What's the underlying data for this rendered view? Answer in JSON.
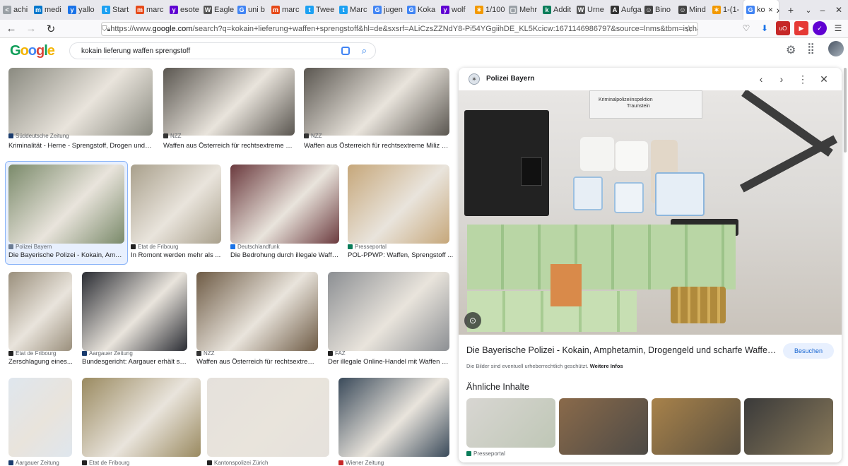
{
  "browser": {
    "tabs": [
      {
        "label": "achi",
        "color": "#9aa0a6",
        "glyph": "<"
      },
      {
        "label": "medi",
        "color": "#0077cc",
        "glyph": "m"
      },
      {
        "label": "yallo",
        "color": "#1a73e8",
        "glyph": "y"
      },
      {
        "label": "Start",
        "color": "#1da1f2",
        "glyph": "t"
      },
      {
        "label": "marc",
        "color": "#e64a19",
        "glyph": "m"
      },
      {
        "label": "esote",
        "color": "#6001d2",
        "glyph": "y"
      },
      {
        "label": "Eagle",
        "color": "#555555",
        "glyph": "W"
      },
      {
        "label": "uni b",
        "color": "#4285f4",
        "glyph": "G"
      },
      {
        "label": "marc",
        "color": "#e64a19",
        "glyph": "m"
      },
      {
        "label": "Twee",
        "color": "#1da1f2",
        "glyph": "t"
      },
      {
        "label": "Marc",
        "color": "#1da1f2",
        "glyph": "t"
      },
      {
        "label": "jugen",
        "color": "#4285f4",
        "glyph": "G"
      },
      {
        "label": "Koka",
        "color": "#4285f4",
        "glyph": "G"
      },
      {
        "label": "wolf",
        "color": "#6001d2",
        "glyph": "y"
      },
      {
        "label": "1/100",
        "color": "#f29900",
        "glyph": "✶"
      },
      {
        "label": "Mehr",
        "color": "#9aa0a6",
        "glyph": "▢"
      },
      {
        "label": "Addit",
        "color": "#0a7d5a",
        "glyph": "k"
      },
      {
        "label": "Urne",
        "color": "#555555",
        "glyph": "W"
      },
      {
        "label": "Aufga",
        "color": "#333333",
        "glyph": "A"
      },
      {
        "label": "Bino",
        "color": "#444444",
        "glyph": "☺"
      },
      {
        "label": "Mind",
        "color": "#444444",
        "glyph": "☺"
      },
      {
        "label": "1-(1-",
        "color": "#f29900",
        "glyph": "✶"
      },
      {
        "label": "ko",
        "color": "#4285f4",
        "glyph": "G"
      }
    ],
    "new_tab": "+",
    "url_prefix": "https://www.",
    "url_domain": "google.com",
    "url_rest": "/search?q=kokain+lieferung+waffen+sprengstoff&hl=de&sxsrf=ALiCzsZZNdY8-Pi54YGgiihDE_KL5Kcicw:1671146986797&source=lnms&tbm=isch&sa=X&ved"
  },
  "google": {
    "logo_letters": [
      [
        "G",
        "#0f9d58"
      ],
      [
        "o",
        "#f4b400"
      ],
      [
        "o",
        "#4285f4"
      ],
      [
        "g",
        "#db4437"
      ],
      [
        "l",
        "#0f9d58"
      ],
      [
        "e",
        "#f4b400"
      ]
    ],
    "query": "kokain lieferung waffen sprengstoff"
  },
  "results": [
    {
      "source": "Süddeutsche Zeitung",
      "title": "Kriminalität - Herne - Sprengstoff, Drogen und W...",
      "icon": "#1a3c6e",
      "bg": "#8a8a80"
    },
    {
      "source": "NZZ",
      "title": "Waffen aus Österreich für rechtsextreme Mil...",
      "icon": "#333333",
      "bg": "#5a5650"
    },
    {
      "source": "NZZ",
      "title": "Waffen aus Österreich für rechtsextreme Miliz in ...",
      "icon": "#333333",
      "bg": "#5a5650"
    },
    {
      "source": "Polizei Bayern",
      "title": "Die Bayerische Polizei - Kokain, Amp...",
      "icon": "#6b7c93",
      "bg": "#7a8a6a"
    },
    {
      "source": "Etat de Fribourg",
      "title": "In Romont werden mehr als ...",
      "icon": "#222222",
      "bg": "#a9a08c"
    },
    {
      "source": "Deutschlandfunk",
      "title": "Die Bedrohung durch illegale Waffe...",
      "icon": "#1a73e8",
      "bg": "#6b3a3e"
    },
    {
      "source": "Presseportal",
      "title": "POL-PPWP: Waffen, Sprengstoff ...",
      "icon": "#0a7d5a",
      "bg": "#c6a77a"
    },
    {
      "source": "Etat de Fribourg",
      "title": "Zerschlagung eines...",
      "icon": "#222222",
      "bg": "#9a8f7c"
    },
    {
      "source": "Aargauer Zeitung",
      "title": "Bundesgericht: Aargauer erhält sei...",
      "icon": "#1a3c6e",
      "bg": "#2a2c33"
    },
    {
      "source": "NZZ",
      "title": "Waffen aus Österreich für rechtsextreme...",
      "icon": "#333333",
      "bg": "#6e5b45"
    },
    {
      "source": "FAZ",
      "title": "Der illegale Online-Handel mit Waffen un...",
      "icon": "#222222",
      "bg": "#8c8f93"
    },
    {
      "source": "Aargauer Zeitung",
      "title": "",
      "icon": "#1a3c6e",
      "bg": "#dfe6ee"
    },
    {
      "source": "Etat de Fribourg",
      "title": "",
      "icon": "#222222",
      "bg": "#9a8a60"
    },
    {
      "source": "Kantonspolizei Zürich",
      "title": "",
      "icon": "#222222",
      "bg": "#e5e1dc"
    },
    {
      "source": "Wiener Zeitung",
      "title": "",
      "icon": "#c62828",
      "bg": "#3a4a5a"
    }
  ],
  "panel": {
    "source": "Polizei Bayern",
    "sign_line1": "Kriminalpolizeiinspektion",
    "sign_line2": "Traunstein",
    "title": "Die Bayerische Polizei - Kokain, Amphetamin, Drogengeld und scharfe Waffe sicherge...",
    "visit_label": "Besuchen",
    "copyright": "Die Bilder sind eventuell urheberrechtlich geschützt.",
    "more_info": "Weitere Infos",
    "related_heading": "Ähnliche Inhalte",
    "related_source": "Presseportal"
  }
}
